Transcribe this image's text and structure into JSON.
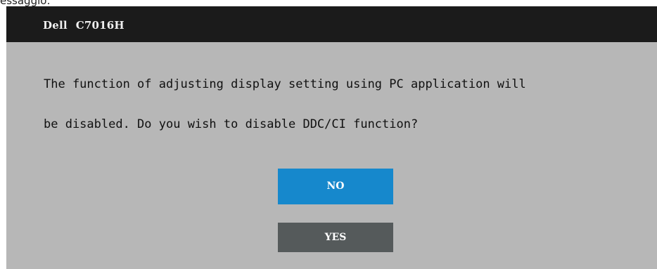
{
  "page_fragment": {
    "text": "essaggio:"
  },
  "osd": {
    "brand": "Dell",
    "model": "C7016H",
    "message_line1": "The function of adjusting display setting using PC application will",
    "message_line2": "be disabled. Do you wish to disable DDC/CI function?",
    "buttons": {
      "no_label": "NO",
      "yes_label": "YES"
    }
  },
  "colors": {
    "panel_bg": "#b7b7b7",
    "titlebar_bg": "#1b1b1b",
    "no_button": "#1688cc",
    "yes_button": "#555a5b"
  }
}
